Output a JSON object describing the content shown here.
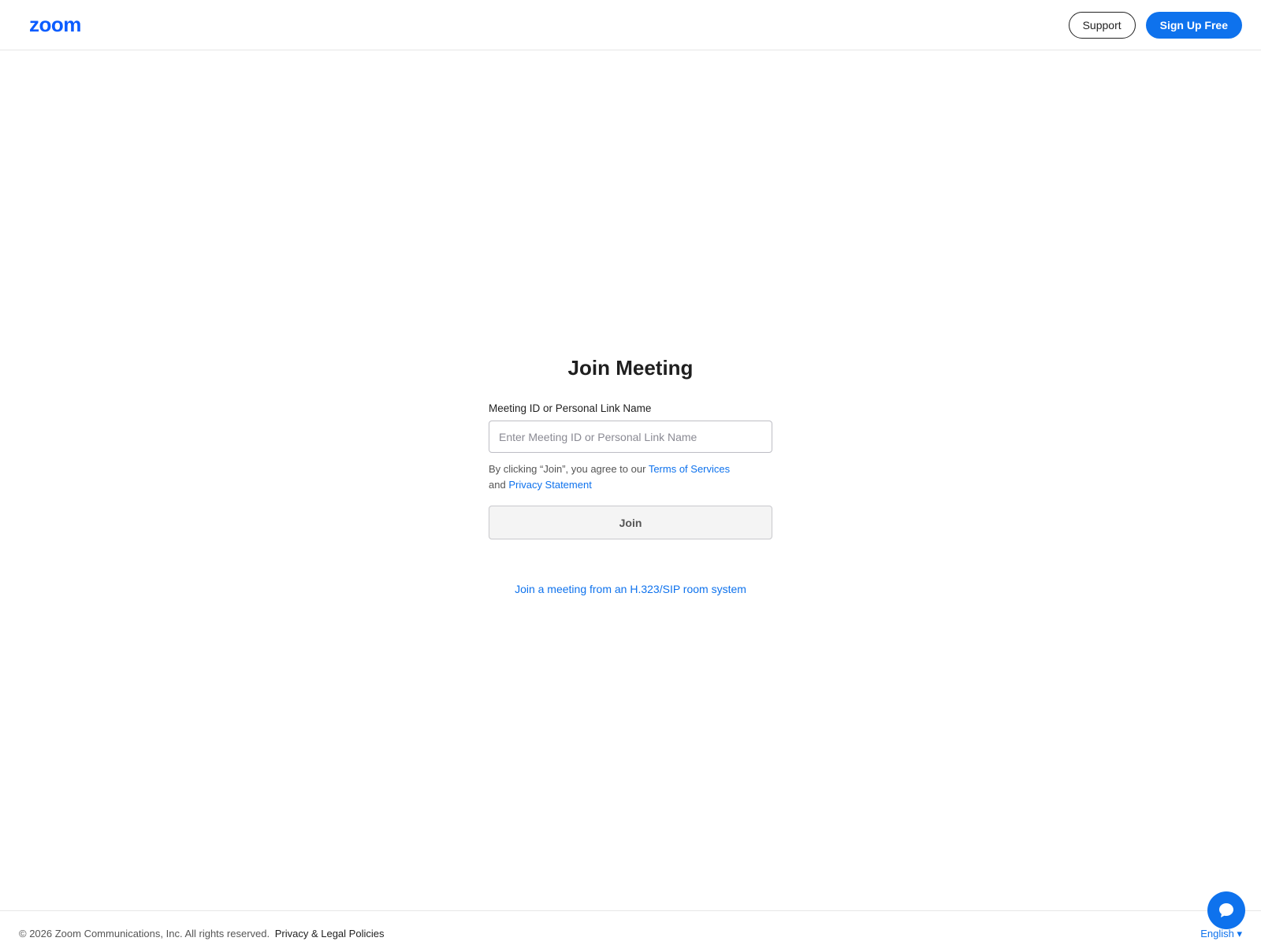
{
  "header": {
    "logo": "zoom",
    "support_label": "Support",
    "signup_label": "Sign Up Free"
  },
  "main": {
    "title": "Join Meeting",
    "field_label": "Meeting ID or Personal Link Name",
    "input_placeholder": "Enter Meeting ID or Personal Link Name",
    "input_value": "",
    "agree_prefix": "By clicking “Join”, you agree to our",
    "terms_link": "Terms of Services",
    "agree_and": "and",
    "privacy_link": "Privacy Statement",
    "join_label": "Join",
    "sip_link": "Join a meeting from an H.323/SIP room system"
  },
  "footer": {
    "copyright": "© 2026 Zoom Communications, Inc. All rights reserved.",
    "legal_link": "Privacy & Legal Policies",
    "language": "English ▾"
  },
  "icons": {
    "chat": "chat-bubble-icon"
  },
  "colors": {
    "brand": "#0b5cff",
    "accent": "#0e72ed"
  }
}
